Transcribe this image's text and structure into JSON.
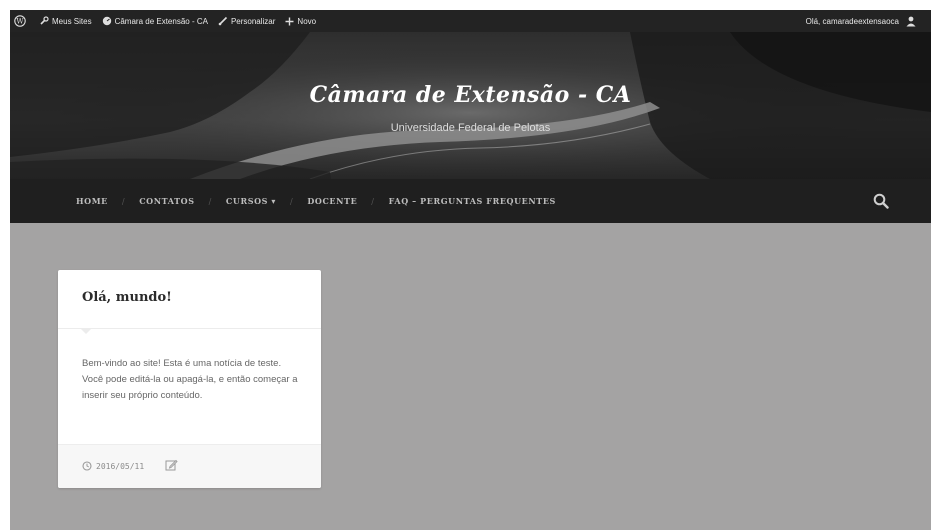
{
  "admin_bar": {
    "my_sites": "Meus Sites",
    "site_name": "Câmara de Extensão - CA",
    "customize": "Personalizar",
    "new": "Novo",
    "greeting": "Olá, camaradeextensaoca"
  },
  "header": {
    "title": "Câmara de Extensão - CA",
    "description": "Universidade Federal de Pelotas"
  },
  "nav": {
    "items": [
      {
        "label": "HOME"
      },
      {
        "label": "CONTATOS"
      },
      {
        "label": "CURSOS ▾"
      },
      {
        "label": "DOCENTE"
      },
      {
        "label": "FAQ – PERGUNTAS FREQUENTES"
      }
    ]
  },
  "post": {
    "title": "Olá, mundo!",
    "excerpt": "Bem-vindo ao site! Esta é uma notícia de teste. Você pode editá-la ou apagá-la, e então começar a inserir seu próprio conteúdo.",
    "date": "2016/05/11"
  },
  "colors": {
    "admin_bar": "#232323",
    "nav_bg": "#1f1f1f",
    "page_bg": "#a4a3a3",
    "card_bg": "#ffffff"
  },
  "icons": [
    "wordpress-icon",
    "wrench-icon",
    "dashboard-icon",
    "brush-icon",
    "plus-icon",
    "user-icon",
    "search-icon",
    "clock-icon",
    "edit-icon"
  ]
}
